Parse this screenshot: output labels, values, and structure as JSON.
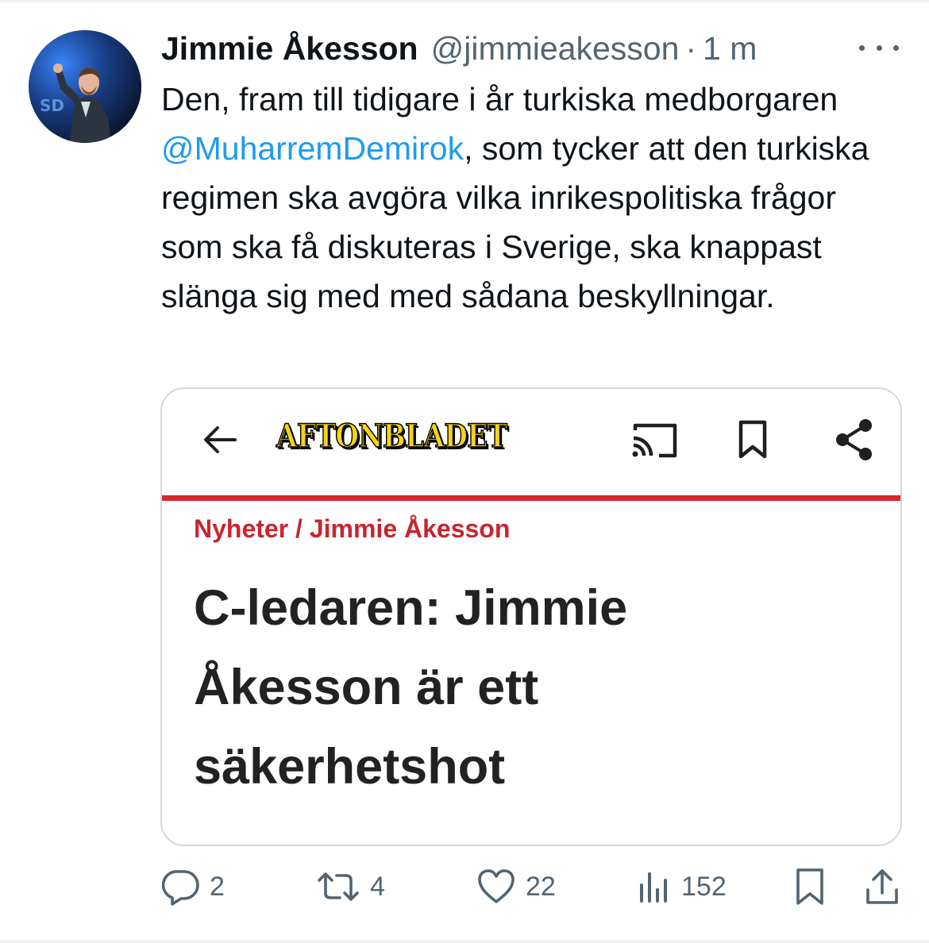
{
  "tweet": {
    "author": {
      "display_name": "Jimmie Åkesson",
      "handle": "@jimmieakesson",
      "separator": "·",
      "timestamp": "1 m"
    },
    "text": {
      "before_mention": "Den, fram till tidigare i år turkiska medborgaren ",
      "mention": "@MuharremDemirok",
      "after_mention": ", som tycker att den turkiska regimen ska avgöra vilka inrikespolitiska frågor som ska få diskuteras i Sverige, ska knappast slänga sig med med sådana beskyllningar."
    },
    "embedded_article": {
      "publication": "AFTONBLADET",
      "breadcrumb": "Nyheter / Jimmie Åkesson",
      "headline": "C-ledaren: Jimmie Åkesson är ett säkerhetshot",
      "accent_color": "#d7262d",
      "logo_color": "#f5d415"
    },
    "actions": {
      "replies": "2",
      "retweets": "4",
      "likes": "22",
      "views": "152"
    }
  },
  "colors": {
    "text": "#0f1419",
    "secondary": "#536471",
    "link": "#1d9bf0",
    "border": "#cfd9de"
  }
}
